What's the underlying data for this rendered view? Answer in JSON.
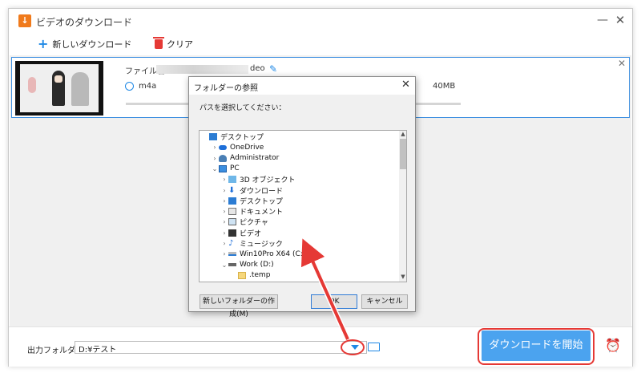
{
  "window": {
    "title": "ビデオのダウンロード"
  },
  "toolbar": {
    "new_download": "新しいダウンロード",
    "clear": "クリア"
  },
  "task": {
    "file_label": "ファイル名:",
    "file_name_visible": "deo",
    "format": "m4a",
    "size": "40MB",
    "progress": 0
  },
  "dialog": {
    "title": "フォルダーの参照",
    "instruction": "パスを選択してください：",
    "tree": [
      {
        "label": "デスクトップ",
        "icon": "desktop-icon",
        "level": 0,
        "expander": ""
      },
      {
        "label": "OneDrive",
        "icon": "cloud-icon",
        "level": 1,
        "expander": ">"
      },
      {
        "label": "Administrator",
        "icon": "user-icon",
        "level": 1,
        "expander": ">"
      },
      {
        "label": "PC",
        "icon": "pc-icon",
        "level": 1,
        "expander": "v"
      },
      {
        "label": "3D オブジェクト",
        "icon": "3d-objects-icon",
        "level": 2,
        "expander": ">"
      },
      {
        "label": "ダウンロード",
        "icon": "download-icon",
        "level": 2,
        "expander": ">"
      },
      {
        "label": "デスクトップ",
        "icon": "desktop-icon",
        "level": 2,
        "expander": ">"
      },
      {
        "label": "ドキュメント",
        "icon": "documents-icon",
        "level": 2,
        "expander": ">"
      },
      {
        "label": "ピクチャ",
        "icon": "pictures-icon",
        "level": 2,
        "expander": ">"
      },
      {
        "label": "ビデオ",
        "icon": "videos-icon",
        "level": 2,
        "expander": ">"
      },
      {
        "label": "ミュージック",
        "icon": "music-icon",
        "level": 2,
        "expander": ">"
      },
      {
        "label": "Win10Pro X64 (C:)",
        "icon": "drive-c-icon",
        "level": 2,
        "expander": ">"
      },
      {
        "label": "Work (D:)",
        "icon": "drive-d-icon",
        "level": 2,
        "expander": "v"
      },
      {
        "label": ".temp",
        "icon": "folder-icon",
        "level": 3,
        "expander": ""
      }
    ],
    "new_folder": "新しいフォルダーの作成(M)",
    "ok": "OK",
    "cancel": "キャンセル"
  },
  "bottom": {
    "output_label": "出力フォルダ：",
    "output_path": "D:¥テスト",
    "start": "ダウンロードを開始"
  },
  "colors": {
    "accent": "#1e88e5",
    "start_button": "#4ba3ef",
    "annotation": "#e53935"
  }
}
